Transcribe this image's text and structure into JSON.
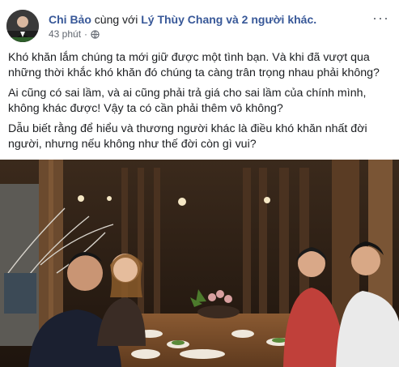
{
  "post": {
    "author": "Chi Bảo",
    "with_text": "cùng với",
    "with_tagged": "Lý Thùy Chang và 2 người khác.",
    "time": "43 phút",
    "separator": "·",
    "privacy_icon": "globe-icon",
    "more_icon": "ellipsis-icon",
    "paragraphs": [
      "Khó khăn lắm chúng ta mới giữ được một tình bạn. Và khi đã vượt qua những thời khắc khó khăn đó chúng ta càng trân trọng nhau phải không?",
      "Ai cũng có sai lầm, và ai cũng phải trả giá cho sai lầm của chính mình, không khác được! Vậy ta có cần phải thêm vô không?",
      "Dẫu biết rằng để hiểu và thương người khác là điều khó khăn nhất đời người, nhưng nếu không như thế đời còn gì vui?"
    ]
  },
  "colors": {
    "link": "#385898",
    "text": "#1c1e21",
    "meta": "#616770"
  }
}
